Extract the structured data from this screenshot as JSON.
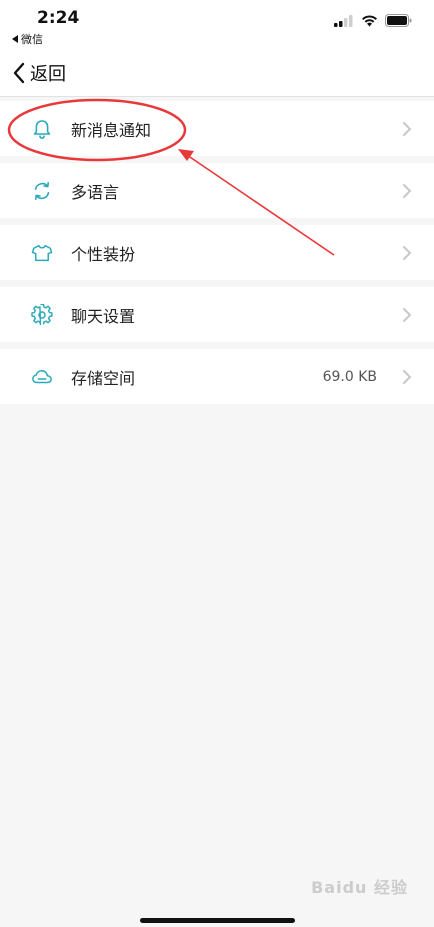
{
  "status_bar": {
    "time": "2:24",
    "back_app": "微信",
    "icons": [
      "signal-icon",
      "wifi-icon",
      "battery-icon"
    ]
  },
  "nav": {
    "back_label": "返回",
    "back_icon": "chevron-left-icon"
  },
  "menu": {
    "items": [
      {
        "label": "新消息通知",
        "icon": "bell-icon",
        "value": ""
      },
      {
        "label": "多语言",
        "icon": "refresh-icon",
        "value": ""
      },
      {
        "label": "个性装扮",
        "icon": "tshirt-icon",
        "value": ""
      },
      {
        "label": "聊天设置",
        "icon": "gear-icon",
        "value": ""
      },
      {
        "label": "存储空间",
        "icon": "cloud-icon",
        "value": "69.0 KB"
      }
    ]
  },
  "annotation": {
    "color": "#e8383a",
    "highlighted_item": "新消息通知"
  },
  "watermark": {
    "text": "Baidu 经验"
  },
  "colors": {
    "accent": "#2aa9b8",
    "background": "#f6f6f6",
    "row": "#ffffff",
    "chevron": "#c7c7cc"
  }
}
